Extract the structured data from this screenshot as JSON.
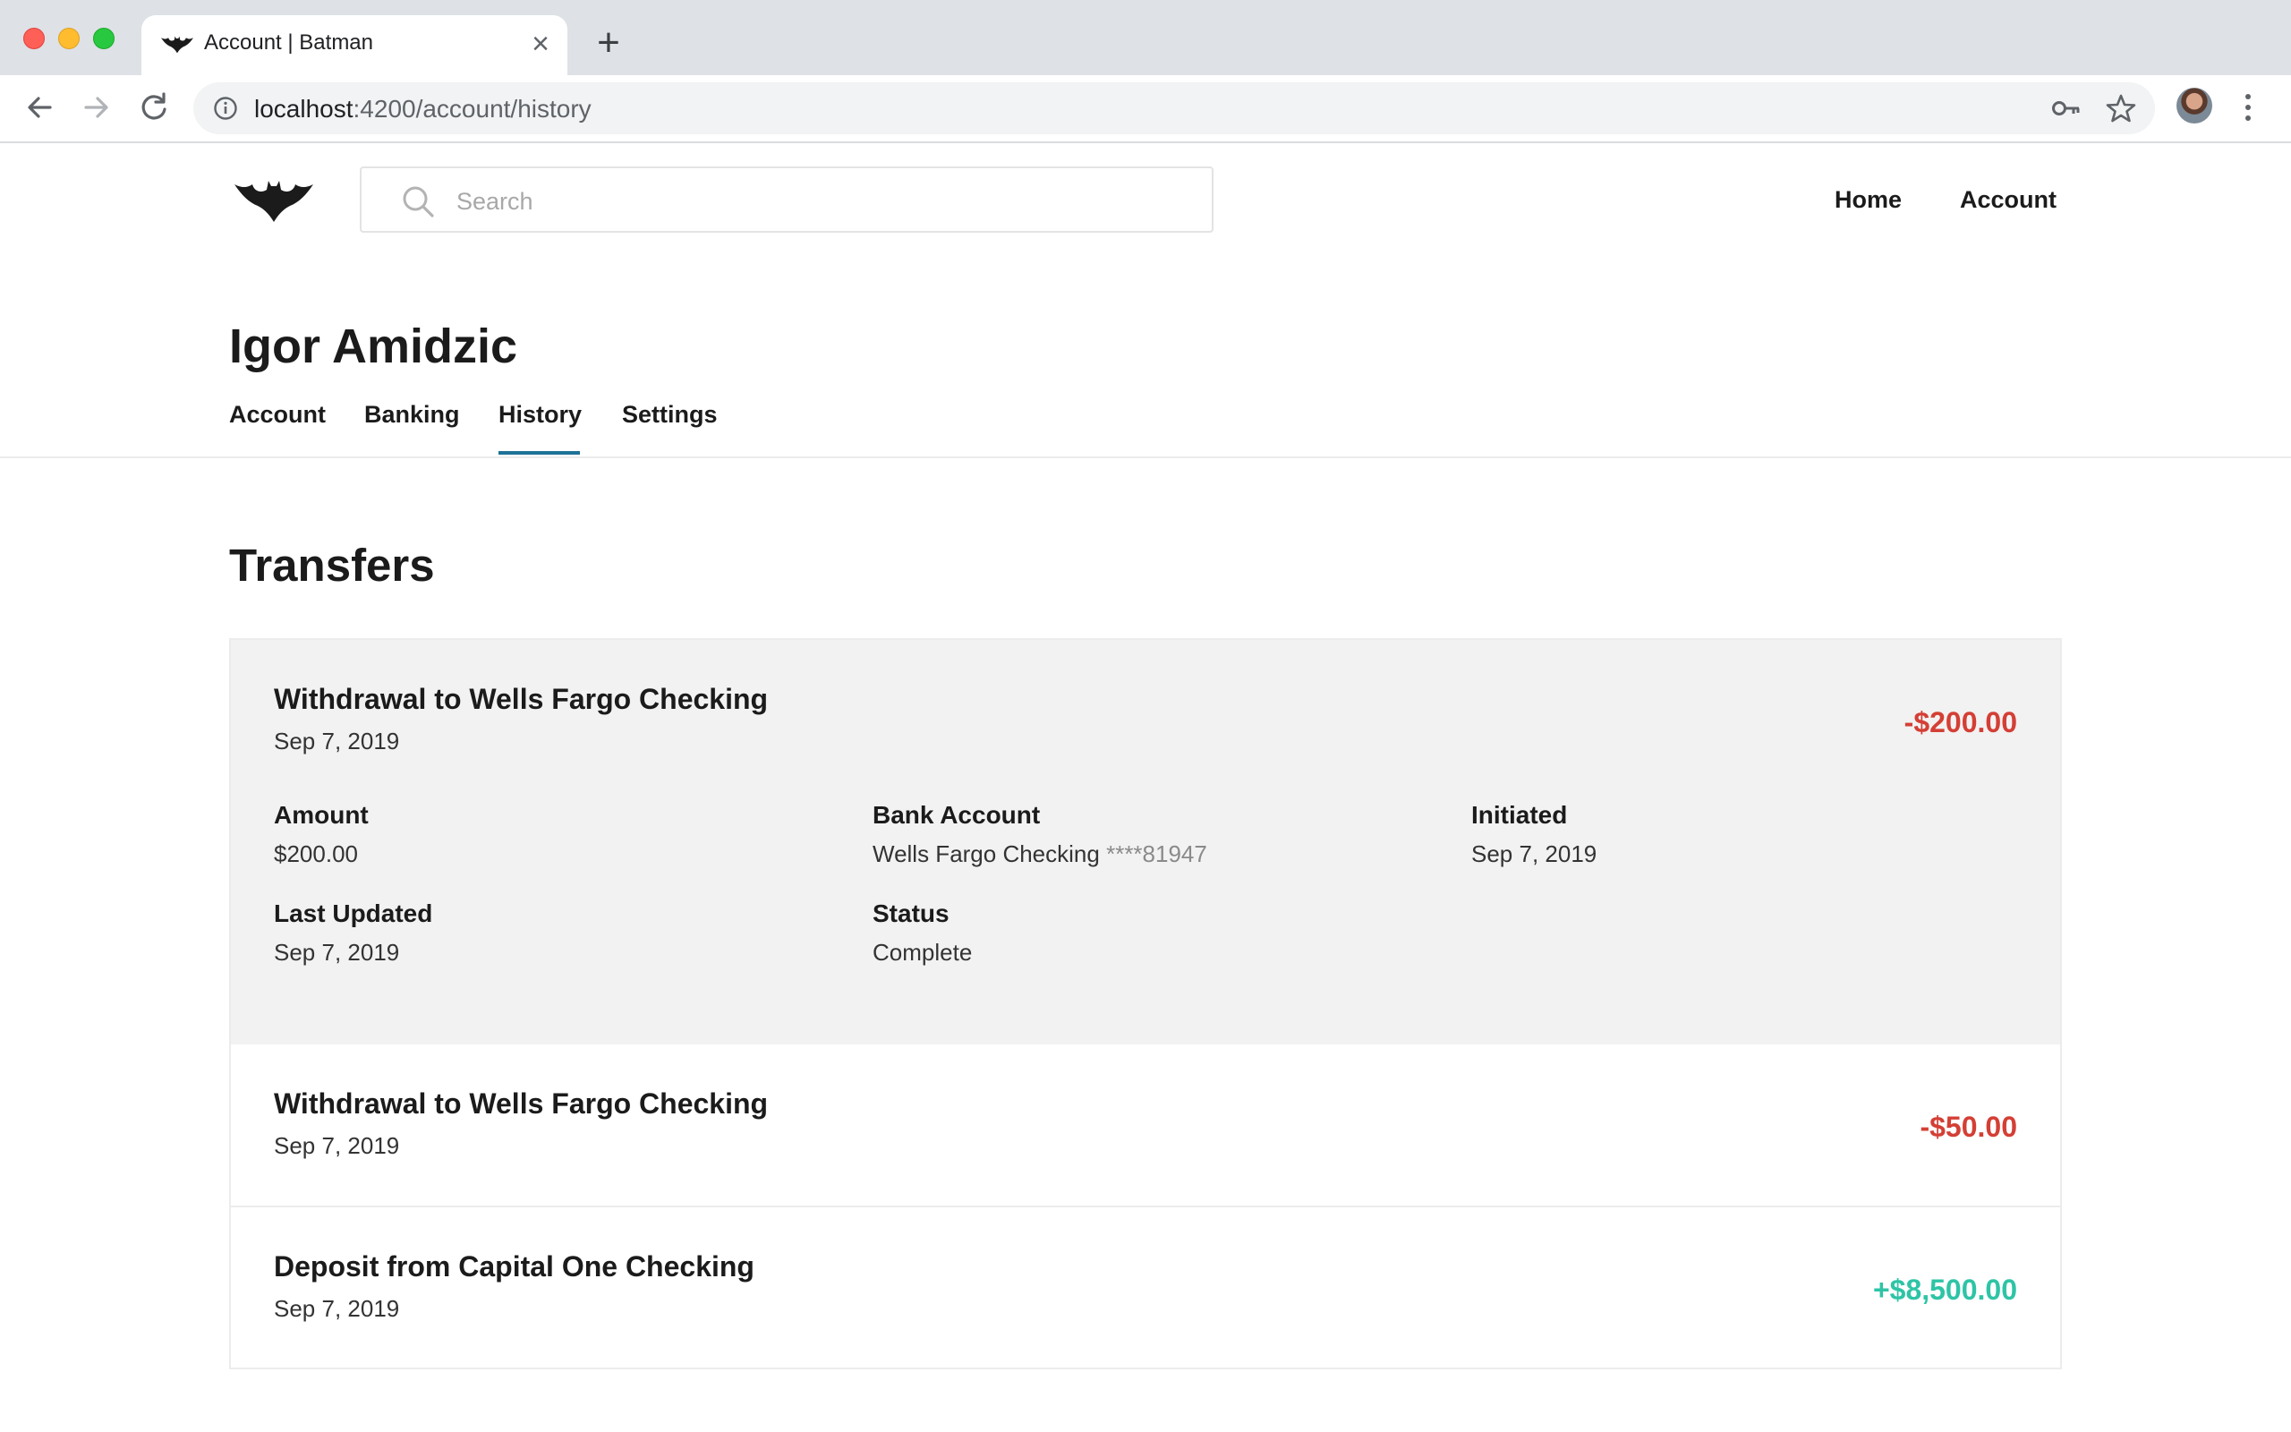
{
  "browser": {
    "tab_title": "Account | Batman",
    "url_host": "localhost",
    "url_path": ":4200/account/history"
  },
  "header": {
    "search_placeholder": "Search",
    "nav": {
      "home": "Home",
      "account": "Account"
    }
  },
  "profile": {
    "name": "Igor Amidzic",
    "tabs": [
      "Account",
      "Banking",
      "History",
      "Settings"
    ],
    "active_tab": "History"
  },
  "transfers": {
    "title": "Transfers",
    "items": [
      {
        "title": "Withdrawal to Wells Fargo Checking",
        "date": "Sep 7, 2019",
        "amount": "-$200.00",
        "expanded": true,
        "details": {
          "amount_label": "Amount",
          "amount_value": "$200.00",
          "bank_label": "Bank Account",
          "bank_name": "Wells Fargo Checking",
          "bank_mask": "****81947",
          "initiated_label": "Initiated",
          "initiated_value": "Sep 7, 2019",
          "updated_label": "Last Updated",
          "updated_value": "Sep 7, 2019",
          "status_label": "Status",
          "status_value": "Complete"
        }
      },
      {
        "title": "Withdrawal to Wells Fargo Checking",
        "date": "Sep 7, 2019",
        "amount": "-$50.00",
        "expanded": false
      },
      {
        "title": "Deposit from Capital One Checking",
        "date": "Sep 7, 2019",
        "amount": "+$8,500.00",
        "expanded": false
      }
    ]
  },
  "colors": {
    "negative": "#d43f35",
    "positive": "#2ec4a6",
    "active_tab_underline": "#1e7296",
    "expanded_row_bg": "#f2f2f2"
  },
  "icons": [
    "bat-logo-icon",
    "search-icon",
    "back-arrow-icon",
    "forward-arrow-icon",
    "reload-icon",
    "info-icon",
    "key-icon",
    "star-icon",
    "close-icon",
    "plus-icon",
    "kebab-menu-icon"
  ]
}
